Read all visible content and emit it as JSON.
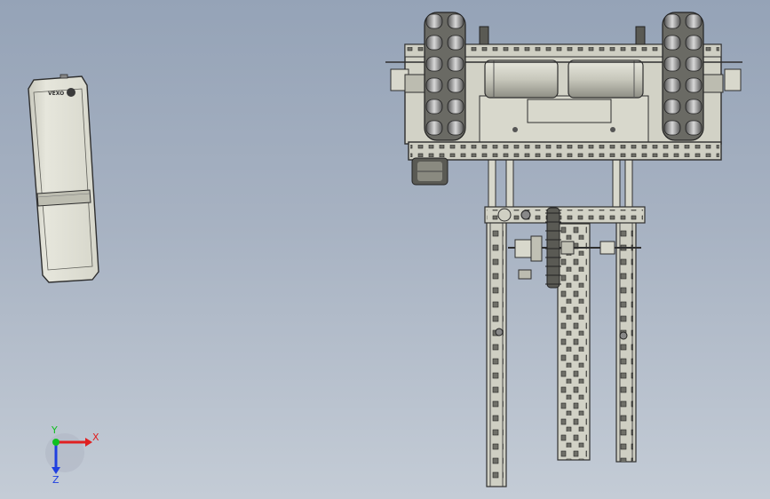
{
  "viewport": {
    "background_top": "#95a3b7",
    "background_bottom": "#c4ccd6"
  },
  "model": {
    "part_color": "#d2d2c6",
    "edge_color": "#2e2e2e",
    "shade_color": "#9a9a90",
    "battery_logo_text": "VEXO"
  },
  "triad": {
    "x_label": "X",
    "y_label": "Y",
    "z_label": "Z",
    "x_color": "#e02020",
    "y_color": "#10c020",
    "z_color": "#2040e0"
  }
}
